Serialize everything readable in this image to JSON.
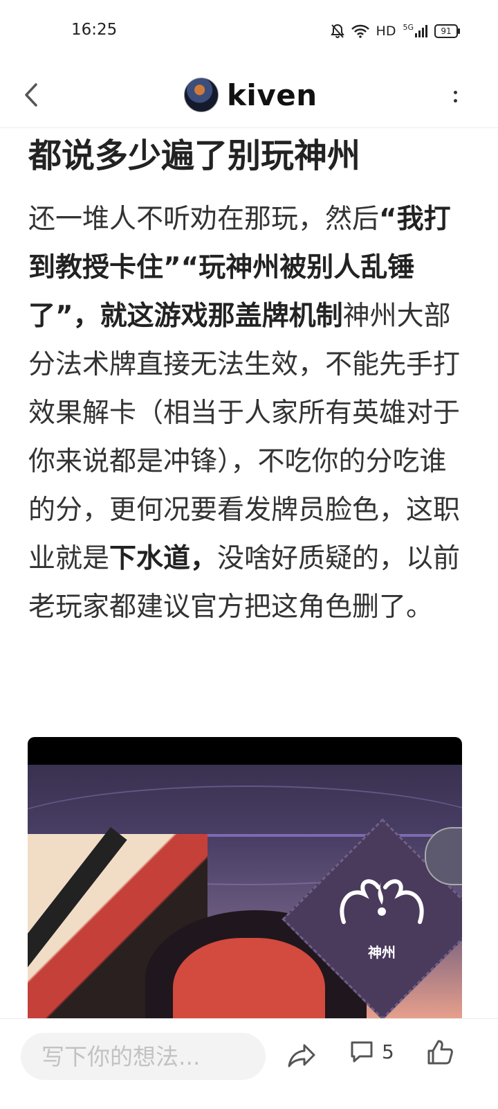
{
  "status_bar": {
    "time": "16:25",
    "network": "HD",
    "signal_label": "5G",
    "battery": "91"
  },
  "header": {
    "author": "kiven"
  },
  "post": {
    "title": "都说多少遍了别玩神州",
    "body_segments": [
      {
        "text": "还一堆人不听劝在那玩，然后",
        "bold": false
      },
      {
        "text": "“我打到教授卡住”“玩神州被别人乱锤了”，就这游戏那盖牌机制",
        "bold": true
      },
      {
        "text": "神州大部分法术牌直接无法生效，不能先手打效果解卡（相当于人家所有英雄对于你来说都是冲锋），不吃你的分吃谁的分，更何况要看发牌员脸色，这职业就是",
        "bold": false
      },
      {
        "text": "下水道，",
        "bold": true
      },
      {
        "text": "没啥好质疑的，以前老玩家都建议官方把这角色删了。",
        "bold": false
      }
    ],
    "image_label": "神州"
  },
  "bottom_bar": {
    "input_placeholder": "写下你的想法...",
    "comment_count": "5"
  }
}
